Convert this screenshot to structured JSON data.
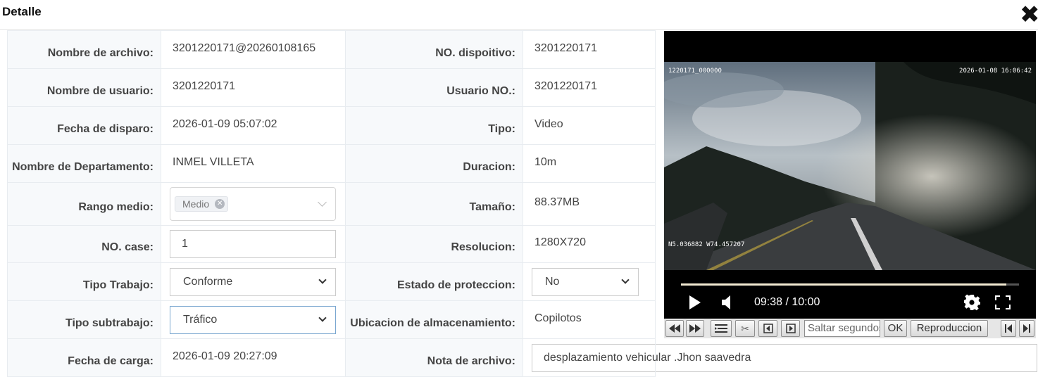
{
  "dialog": {
    "title": "Detalle",
    "close_icon": "close-icon"
  },
  "labels": {
    "file_name": "Nombre de archivo:",
    "device_no": "NO. dispoitivo:",
    "user_name": "Nombre de usuario:",
    "user_no": "Usuario NO.:",
    "trigger_date": "Fecha de disparo:",
    "type": "Tipo:",
    "department": "Nombre de Departamento:",
    "duration": "Duracion:",
    "medium_range": "Rango medio:",
    "size": "Tamaño:",
    "case_no": "NO. case:",
    "resolution": "Resolucion:",
    "work_type": "Tipo Trabajo:",
    "protection": "Estado de proteccion:",
    "subwork_type": "Tipo subtrabajo:",
    "storage": "Ubicacion de almacenamiento:",
    "upload_date": "Fecha de carga:",
    "file_note": "Nota de archivo:"
  },
  "values": {
    "file_name": "3201220171@20260108165",
    "device_no": "3201220171",
    "user_name": "3201220171",
    "user_no": "3201220171",
    "trigger_date": "2026-01-09 05:07:02",
    "type": "Video",
    "department": "INMEL VILLETA",
    "duration": "10m",
    "medium_range_tag": "Medio",
    "size": "88.37MB",
    "case_no": "1",
    "resolution": "1280X720",
    "work_type": "Conforme",
    "protection": "No",
    "subwork_type": "Tráfico",
    "storage": "Copilotos",
    "upload_date": "2026-01-09 20:27:09",
    "file_note": "desplazamiento vehicular .Jhon saavedra"
  },
  "player": {
    "osd_top_left": "1220171_000000",
    "osd_top_right": "2026-01-08 16:06:42",
    "osd_gps": "N5.036882 W74.457207",
    "time": "09:38 / 10:00",
    "progress": 0.963
  },
  "toolbar": {
    "skip_placeholder": "Saltar segundos",
    "ok": "OK",
    "playback": "Reproduccion"
  }
}
